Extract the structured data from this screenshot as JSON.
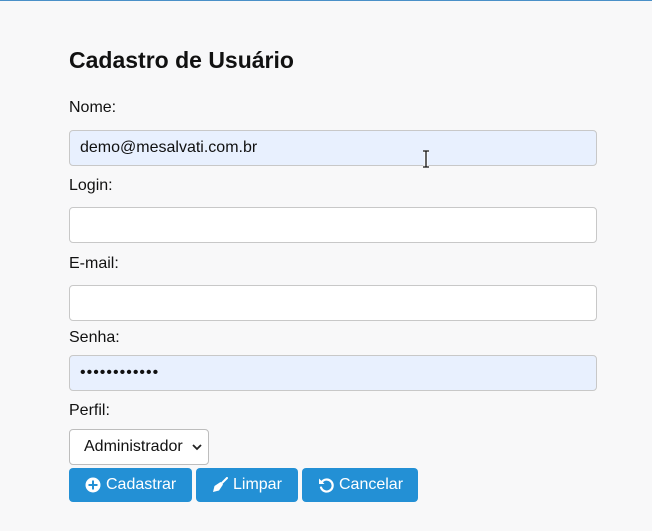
{
  "form": {
    "title": "Cadastro de Usuário",
    "fields": {
      "nome": {
        "label": "Nome:",
        "value": "demo@mesalvati.com.br"
      },
      "login": {
        "label": "Login:",
        "value": ""
      },
      "email": {
        "label": "E-mail:",
        "value": ""
      },
      "senha": {
        "label": "Senha:",
        "value": "••••••••••••"
      },
      "perfil": {
        "label": "Perfil:",
        "selected": "Administrador"
      }
    },
    "buttons": {
      "cadastrar": "Cadastrar",
      "limpar": "Limpar",
      "cancelar": "Cancelar"
    }
  },
  "colors": {
    "accent": "#2390d5",
    "autofill": "#e8f0fe"
  },
  "icons": {
    "cadastrar": "plus-circle-icon",
    "limpar": "broom-icon",
    "cancelar": "undo-icon"
  }
}
